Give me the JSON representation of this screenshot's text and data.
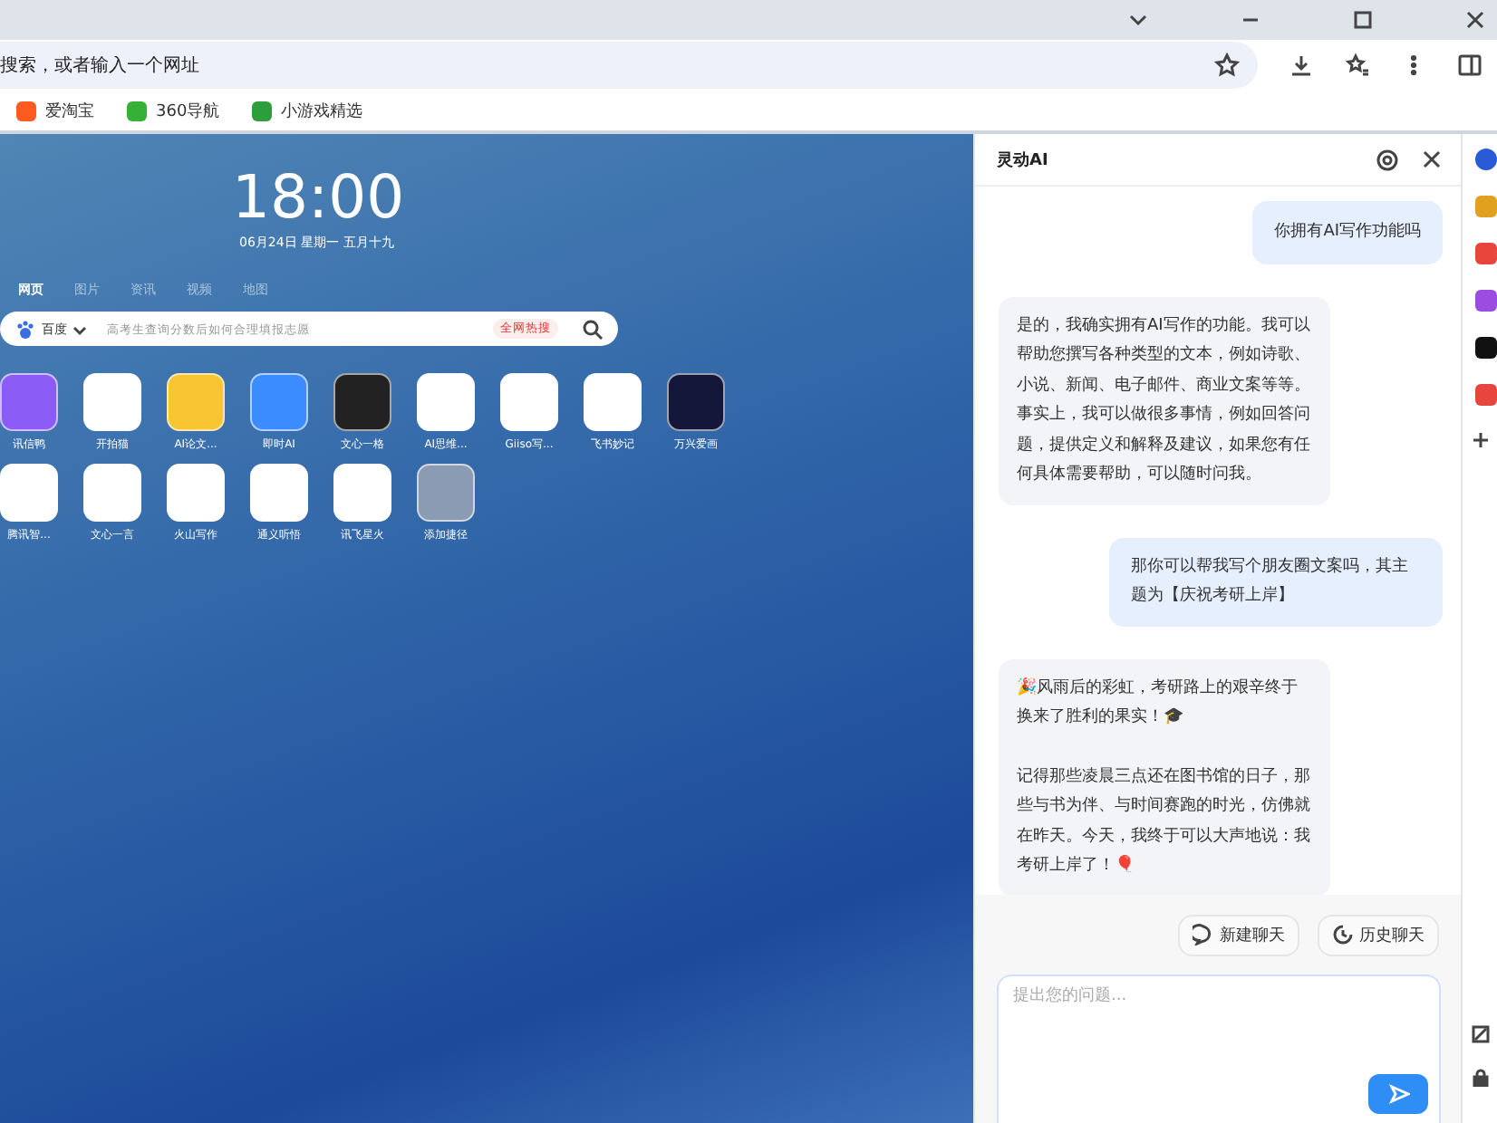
{
  "address_bar": {
    "placeholder": "搜索，或者输入一个网址"
  },
  "bookmarks": [
    {
      "label": "爱淘宝",
      "color": "#ff5a1f"
    },
    {
      "label": "360导航",
      "color": "#35b236"
    },
    {
      "label": "小游戏精选",
      "color": "#2e9e3c"
    }
  ],
  "new_tab": {
    "clock": "18:00",
    "date": "06月24日 星期一 五月十九",
    "search_tabs": [
      {
        "label": "网页",
        "selected": true
      },
      {
        "label": "图片",
        "selected": false
      },
      {
        "label": "资讯",
        "selected": false
      },
      {
        "label": "视频",
        "selected": false
      },
      {
        "label": "地图",
        "selected": false
      }
    ],
    "search": {
      "engine": "百度",
      "placeholder": "高考生查询分数后如何合理填报志愿",
      "hot_badge": "全网热搜"
    },
    "shortcuts": [
      {
        "label": "讯信鸭",
        "color": "#8a5cf5"
      },
      {
        "label": "开拍猫",
        "color": "#ffffff"
      },
      {
        "label": "AI论文...",
        "color": "#f7c531"
      },
      {
        "label": "即时AI",
        "color": "#3b8cff"
      },
      {
        "label": "文心一格",
        "color": "#222222"
      },
      {
        "label": "AI思维...",
        "color": "#ffffff"
      },
      {
        "label": "Giiso写...",
        "color": "#ffffff"
      },
      {
        "label": "飞书妙记",
        "color": "#ffffff"
      },
      {
        "label": "万兴爱画",
        "color": "#14163a"
      },
      {
        "label": "腾讯智...",
        "color": "#ffffff"
      },
      {
        "label": "文心一言",
        "color": "#ffffff"
      },
      {
        "label": "火山写作",
        "color": "#ffffff"
      },
      {
        "label": "通义听悟",
        "color": "#ffffff"
      },
      {
        "label": "讯飞星火",
        "color": "#ffffff"
      },
      {
        "label": "添加捷径",
        "color": "#8a9bb3"
      }
    ]
  },
  "ai_panel": {
    "title": "灵动AI",
    "messages": [
      {
        "kind": "user",
        "text": "你拥有AI写作功能吗"
      },
      {
        "kind": "assistant",
        "paragraphs": [
          "是的，我确实拥有AI写作的功能。我可以帮助您撰写各种类型的文本，例如诗歌、小说、新闻、电子邮件、商业文案等等。事实上，我可以做很多事情，例如回答问题，提供定义和解释及建议，如果您有任何具体需要帮助，可以随时问我。"
        ]
      },
      {
        "kind": "user",
        "text": "那你可以帮我写个朋友圈文案吗，其主题为【庆祝考研上岸】"
      },
      {
        "kind": "assistant",
        "paragraphs": [
          "🎉风雨后的彩虹，考研路上的艰辛终于换来了胜利的果实！🎓",
          "记得那些凌晨三点还在图书馆的日子，那些与书为伴、与时间赛跑的时光，仿佛就在昨天。今天，我终于可以大声地说：我考研上岸了！🎈"
        ]
      }
    ],
    "actions": [
      "新建聊天",
      "历史聊天"
    ],
    "input": {
      "placeholder": "提出您的问题..."
    }
  }
}
